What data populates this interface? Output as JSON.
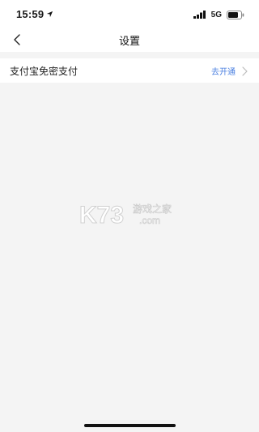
{
  "status_bar": {
    "time": "15:59",
    "network": "5G"
  },
  "nav": {
    "title": "设置"
  },
  "settings": {
    "items": [
      {
        "label": "支付宝免密支付",
        "action_label": "去开通"
      }
    ]
  },
  "watermark": {
    "logo_text": "K73",
    "site_text": "游戏之家",
    "domain_text": ".com"
  },
  "colors": {
    "accent": "#4a7fe0",
    "background": "#f4f4f4",
    "card": "#ffffff"
  }
}
